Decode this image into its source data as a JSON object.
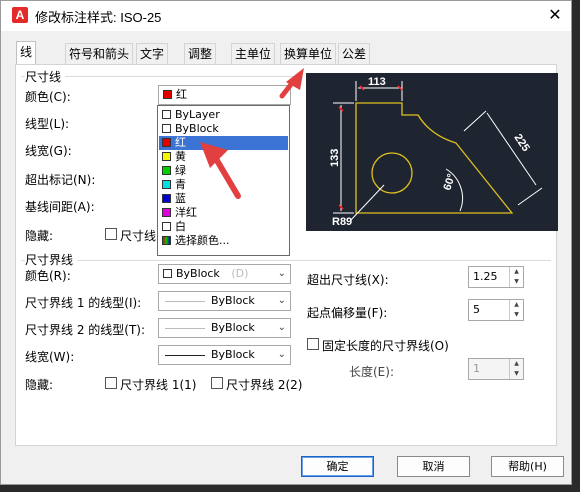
{
  "window": {
    "title": "修改标注样式: ISO-25",
    "app_icon_text": "A"
  },
  "tabs": [
    "线",
    "符号和箭头",
    "文字",
    "调整",
    "主单位",
    "换算单位",
    "公差"
  ],
  "dim_line": {
    "group": "尺寸线",
    "color_label": "颜色(C):",
    "color_value": "红",
    "linetype_label": "线型(L):",
    "lineweight_label": "线宽(G):",
    "extend_label": "超出标记(N):",
    "baseline_label": "基线间距(A):",
    "suppress_label": "隐藏:",
    "suppress_opt1": "尺寸线"
  },
  "color_dropdown": {
    "items": [
      {
        "label": "ByLayer",
        "color": "#ffffff"
      },
      {
        "label": "ByBlock",
        "color": "#ffffff"
      },
      {
        "label": "红",
        "color": "#e00000"
      },
      {
        "label": "黄",
        "color": "#f5f500"
      },
      {
        "label": "绿",
        "color": "#00d000"
      },
      {
        "label": "青",
        "color": "#00e0e0"
      },
      {
        "label": "蓝",
        "color": "#0000d0"
      },
      {
        "label": "洋红",
        "color": "#e000e0"
      },
      {
        "label": "白",
        "color": "#ffffff"
      },
      {
        "label": "选择颜色...",
        "color": "#444444"
      }
    ],
    "selected": "红"
  },
  "ext_line": {
    "group": "尺寸界线",
    "color_label": "颜色(R):",
    "color_value": "ByBlock",
    "color_ghost": "(D)",
    "lt1_label": "尺寸界线 1 的线型(I):",
    "lt1_value": "ByBlock",
    "lt2_label": "尺寸界线 2 的线型(T):",
    "lt2_value": "ByBlock",
    "lw_label": "线宽(W):",
    "lw_value": "ByBlock",
    "suppress_label": "隐藏:",
    "suppress_opt1": "尺寸界线 1(1)",
    "suppress_opt2": "尺寸界线 2(2)",
    "extend_label": "超出尺寸线(X):",
    "extend_value": "1.25",
    "offset_label": "起点偏移量(F):",
    "offset_value": "5",
    "fixed_label": "固定长度的尺寸界线(O)",
    "length_label": "长度(E):",
    "length_value": "1"
  },
  "preview": {
    "dim_top": "113",
    "dim_left": "133",
    "dim_right": "225",
    "angle": "60°",
    "radius": "R89"
  },
  "buttons": {
    "ok": "确定",
    "cancel": "取消",
    "help": "帮助(H)"
  },
  "colors": {
    "accent_red": "#e24040",
    "preview_bg": "#1f2530",
    "dim_white": "#ffffff",
    "geom_yellow": "#e0c020",
    "dim_red": "#ff2020"
  }
}
